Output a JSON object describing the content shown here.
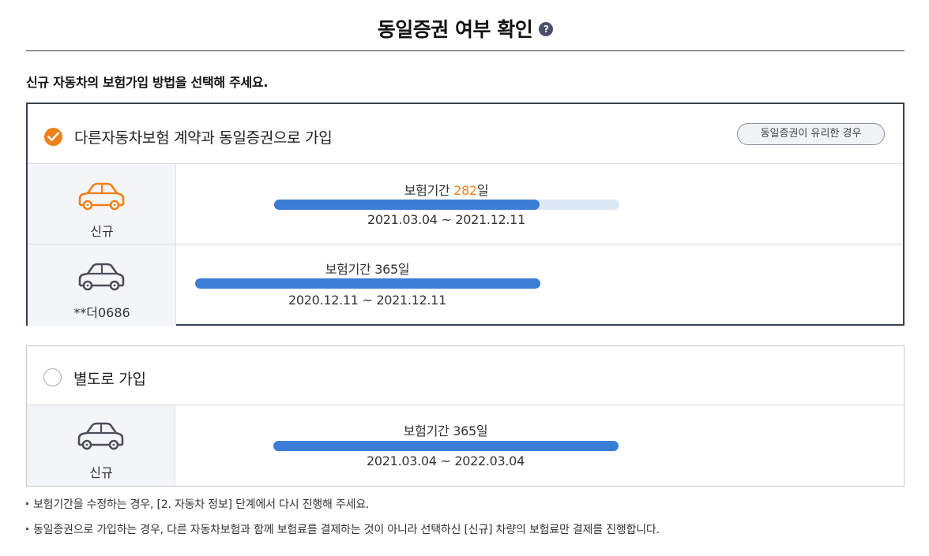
{
  "header": {
    "title": "동일증권 여부 확인",
    "help_icon": "question-circle-icon"
  },
  "subtitle": "신규 자동차의 보험가입 방법을 선택해 주세요.",
  "colors": {
    "accent": "#f08018",
    "bar": "#3a7dd4",
    "bar_track": "#dce8f6",
    "border_dark": "#3a4150"
  },
  "option_same": {
    "label": "다른자동차보험 계약과 동일증권으로 가입",
    "checked": true,
    "tag_label": "동일증권이 유리한 경우",
    "rows": [
      {
        "caption": "신규",
        "period_prefix": "보험기간 ",
        "days": "282",
        "period_suffix": "일",
        "dates": "2021.03.04 ~ 2021.12.11",
        "progress": 0.77
      },
      {
        "caption": "**더0686",
        "period": "보험기간 365일",
        "dates": "2020.12.11 ~ 2021.12.11",
        "progress": 1.0
      }
    ]
  },
  "option_separate": {
    "label": "별도로 가입",
    "checked": false,
    "rows": [
      {
        "caption": "신규",
        "period": "보험기간 365일",
        "dates": "2021.03.04 ~ 2022.03.04",
        "progress": 1.0
      }
    ]
  },
  "notes": [
    "보험기간을 수정하는 경우, [2. 자동차 정보] 단계에서 다시 진행해 주세요.",
    "동일증권으로 가입하는 경우, 다른 자동차보험과 함께 보험료를 결제하는 것이 아니라 선택하신 [신규] 차량의 보험료만 결제를 진행합니다."
  ]
}
